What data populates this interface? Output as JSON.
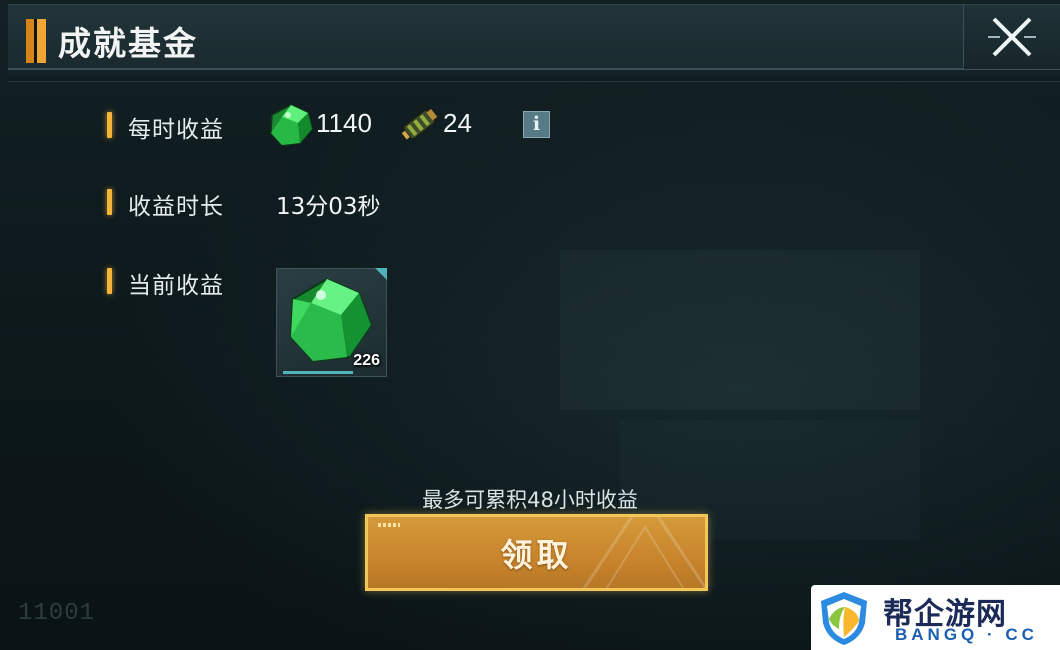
{
  "header": {
    "title": "成就基金",
    "close_icon": "close-x-icon"
  },
  "rows": {
    "hourly_income": {
      "label": "每时收益",
      "resources": [
        {
          "icon": "green-crystal-icon",
          "amount": "1140"
        },
        {
          "icon": "ammo-canister-icon",
          "amount": "24"
        }
      ],
      "info_icon": "i"
    },
    "income_duration": {
      "label": "收益时长",
      "value": "13分03秒"
    },
    "current_income": {
      "label": "当前收益",
      "item": {
        "icon": "green-crystal-icon",
        "count": "226"
      }
    }
  },
  "note": "最多可累积48小时收益",
  "claim_button": {
    "label": "领取"
  },
  "serial": "11001",
  "watermark": {
    "text": "帮企游网",
    "sub": "BANGQ · CC"
  },
  "colors": {
    "accent": "#f5b43a",
    "button": "#c9862d",
    "crystal": "#2fc24a"
  }
}
